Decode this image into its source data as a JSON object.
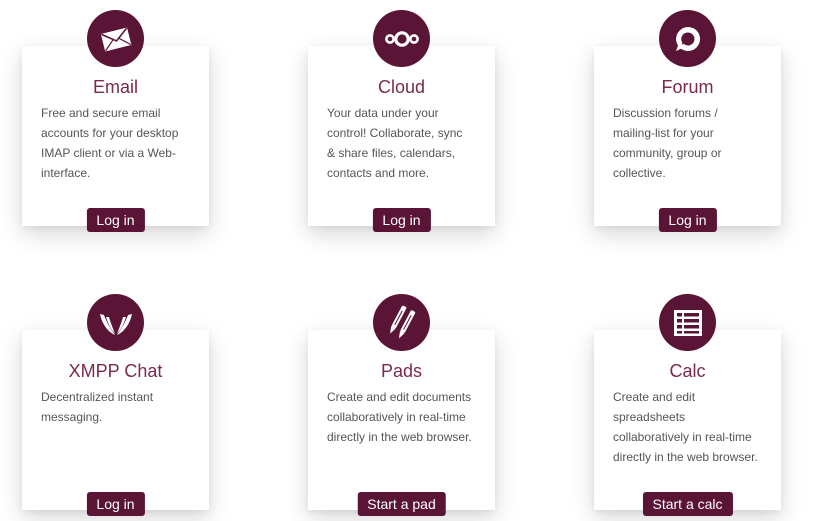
{
  "services": [
    {
      "title": "Email",
      "icon": "envelope-icon",
      "description": "Free and secure email accounts for your desktop IMAP client or via a Web-interface.",
      "button": "Log in"
    },
    {
      "title": "Cloud",
      "icon": "cloud-rings-icon",
      "description": "Your data under your control! Collaborate, sync & share files, calendars, contacts and more.",
      "button": "Log in"
    },
    {
      "title": "Forum",
      "icon": "speech-bubble-icon",
      "description": "Discussion forums / mailing-list for your community, group or collective.",
      "button": "Log in"
    },
    {
      "title": "XMPP Chat",
      "icon": "xmpp-wings-icon",
      "description": "Decentralized instant messaging.",
      "button": "Log in"
    },
    {
      "title": "Pads",
      "icon": "pens-icon",
      "description": "Create and edit documents collaboratively in real-time directly in the web browser.",
      "button": "Start a pad"
    },
    {
      "title": "Calc",
      "icon": "spreadsheet-icon",
      "description": "Create and edit spreadsheets collaboratively in real-time directly in the web browser.",
      "button": "Start a calc"
    }
  ],
  "colors": {
    "accent": "#5a1436",
    "title": "#7a2a4c",
    "text": "#555555"
  }
}
